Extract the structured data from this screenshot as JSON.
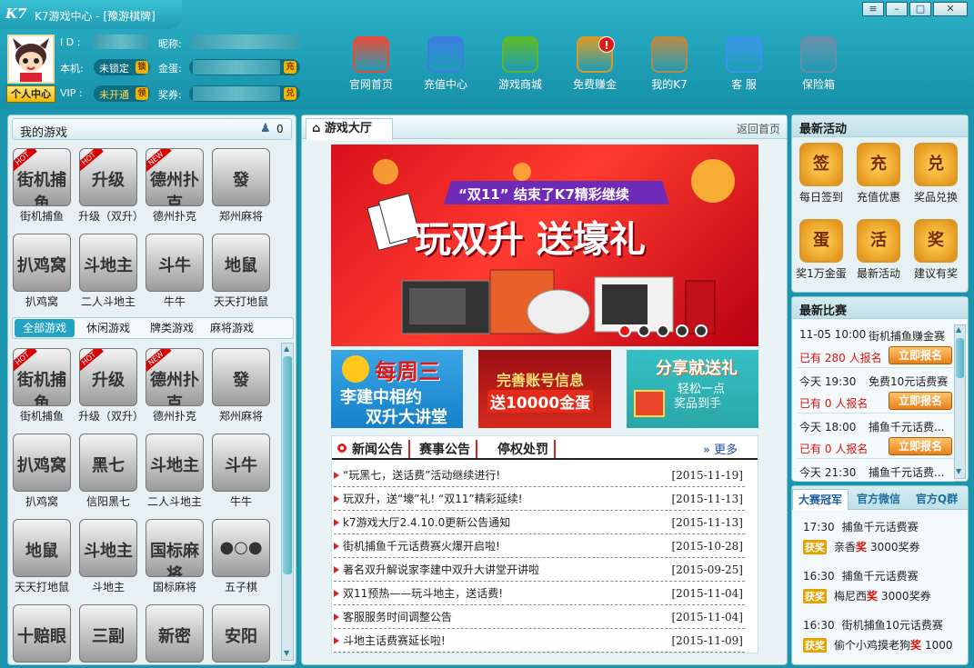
{
  "app": {
    "logo": "K7",
    "title": "K7游戏中心 - [豫游棋牌]"
  },
  "window_controls": {
    "menu": "≡",
    "minimize": "–",
    "maximize": "□",
    "close": "✕"
  },
  "user": {
    "id_label": "I D :",
    "nickname_label": "昵称:",
    "machine_label": "本机:",
    "machine_value": "未锁定",
    "eggs_label": "金蛋:",
    "vip_label": "VIP :",
    "vip_value": "未开通",
    "tickets_label": "奖券:",
    "personal_center": "个人中心",
    "coin_lock": "锁",
    "coin_vip": "领",
    "coin_egg": "充",
    "coin_ticket": "兑"
  },
  "nav": [
    {
      "label": "官网首页",
      "icon": "house-icon",
      "color": "#e84b3c"
    },
    {
      "label": "充值中心",
      "icon": "card-icon",
      "color": "#3b7de0"
    },
    {
      "label": "游戏商城",
      "icon": "basket-icon",
      "color": "#5cb82a"
    },
    {
      "label": "免费赚金",
      "icon": "money-bag-icon",
      "color": "#d89a28"
    },
    {
      "label": "我的K7",
      "icon": "user-icon",
      "color": "#b88946"
    },
    {
      "label": "客 服",
      "icon": "service-icon",
      "color": "#3a96e8"
    },
    {
      "label": "保险箱",
      "icon": "safe-icon",
      "color": "#6a8ea8"
    }
  ],
  "my_games": {
    "title": "我的游戏",
    "count": "0",
    "games": [
      {
        "name": "街机捕鱼",
        "glyph": "街机捕鱼",
        "tag": "HOT"
      },
      {
        "name": "升级（双升）",
        "glyph": "升级",
        "tag": "HOT"
      },
      {
        "name": "德州扑克",
        "glyph": "德州扑克",
        "tag": "NEW"
      },
      {
        "name": "郑州麻将",
        "glyph": "發",
        "tag": ""
      },
      {
        "name": "扒鸡窝",
        "glyph": "扒鸡窝",
        "tag": ""
      },
      {
        "name": "二人斗地主",
        "glyph": "斗地主",
        "tag": ""
      },
      {
        "name": "牛牛",
        "glyph": "斗牛",
        "tag": ""
      },
      {
        "name": "天天打地鼠",
        "glyph": "地鼠",
        "tag": ""
      }
    ]
  },
  "category_tabs": [
    "全部游戏",
    "休闲游戏",
    "牌类游戏",
    "麻将游戏"
  ],
  "all_games": [
    {
      "name": "街机捕鱼",
      "glyph": "街机捕鱼",
      "tag": "HOT"
    },
    {
      "name": "升级（双升）",
      "glyph": "升级",
      "tag": "HOT"
    },
    {
      "name": "德州扑克",
      "glyph": "德州扑克",
      "tag": "NEW"
    },
    {
      "name": "郑州麻将",
      "glyph": "發",
      "tag": ""
    },
    {
      "name": "扒鸡窝",
      "glyph": "扒鸡窝",
      "tag": ""
    },
    {
      "name": "信阳黑七",
      "glyph": "黑七",
      "tag": ""
    },
    {
      "name": "二人斗地主",
      "glyph": "斗地主",
      "tag": ""
    },
    {
      "name": "牛牛",
      "glyph": "斗牛",
      "tag": ""
    },
    {
      "name": "天天打地鼠",
      "glyph": "地鼠",
      "tag": ""
    },
    {
      "name": "斗地主",
      "glyph": "斗地主",
      "tag": ""
    },
    {
      "name": "国标麻将",
      "glyph": "国标麻将",
      "tag": ""
    },
    {
      "name": "五子棋",
      "glyph": "●○●",
      "tag": ""
    },
    {
      "name": "",
      "glyph": "十赔眼",
      "tag": ""
    },
    {
      "name": "",
      "glyph": "三副",
      "tag": ""
    },
    {
      "name": "",
      "glyph": "新密",
      "tag": ""
    },
    {
      "name": "",
      "glyph": "安阳",
      "tag": ""
    }
  ],
  "hall": {
    "tab": "游戏大厅",
    "back": "返回首页"
  },
  "banner": {
    "subtitle": "“双11” 结束了K7精彩继续",
    "title": "玩双升 送壕礼",
    "dots": 5
  },
  "promos": [
    {
      "line1": "每周三",
      "line2": "李建中相约",
      "line3": "双升大讲堂"
    },
    {
      "line1": "完善账号信息",
      "line2": "送10000金蛋"
    },
    {
      "line1": "分享就送礼",
      "line2": "轻松一点",
      "line3": "奖品到手"
    }
  ],
  "news": {
    "tabs": [
      "新闻公告",
      "赛事公告",
      "停权处罚"
    ],
    "more": "更多",
    "items": [
      {
        "title": "“玩黑七，送话费”活动继续进行!",
        "date": "[2015-11-19]"
      },
      {
        "title": "玩双升，送“壕”礼! “双11”精彩延续!",
        "date": "[2015-11-13]"
      },
      {
        "title": "k7游戏大厅2.4.10.0更新公告通知",
        "date": "[2015-11-13]"
      },
      {
        "title": "街机捕鱼千元话费赛火爆开启啦!",
        "date": "[2015-10-28]"
      },
      {
        "title": "著名双升解说家李建中双升大讲堂开讲啦",
        "date": "[2015-09-25]"
      },
      {
        "title": "双11预热——玩斗地主，送话费!",
        "date": "[2015-11-04]"
      },
      {
        "title": "客服服务时间调整公告",
        "date": "[2015-11-04]"
      },
      {
        "title": "斗地主话费赛延长啦!",
        "date": "[2015-11-09]"
      }
    ]
  },
  "activities": {
    "title": "最新活动",
    "items": [
      {
        "label": "每日签到",
        "glyph": "签"
      },
      {
        "label": "充值优惠",
        "glyph": "充"
      },
      {
        "label": "奖品兑换",
        "glyph": "兑"
      },
      {
        "label": "奖1万金蛋",
        "glyph": "蛋"
      },
      {
        "label": "最新活动",
        "glyph": "活"
      },
      {
        "label": "建议有奖",
        "glyph": "奖"
      }
    ]
  },
  "matches": {
    "title": "最新比赛",
    "signup": "立即报名",
    "items": [
      {
        "time": "11-05 10:00",
        "name": "街机捕鱼赚金赛",
        "pre": "已有",
        "count": "280",
        "post": "人报名"
      },
      {
        "time": "今天 19:30",
        "name": "免费10元话费赛",
        "pre": "已有",
        "count": "0",
        "post": "人报名"
      },
      {
        "time": "今天 18:00",
        "name": "捕鱼千元话费...",
        "pre": "已有",
        "count": "0",
        "post": "人报名"
      },
      {
        "time": "今天 21:30",
        "name": "捕鱼千元话费...",
        "pre": "",
        "count": "",
        "post": ""
      }
    ]
  },
  "champions": {
    "tabs": [
      "大赛冠军",
      "官方微信",
      "官方Q群"
    ],
    "award_label": "获奖",
    "prize_word": "奖",
    "items": [
      {
        "time": "17:30",
        "match": "捕鱼千元话费赛",
        "user": "亲香",
        "prize": "3000奖券"
      },
      {
        "time": "16:30",
        "match": "捕鱼千元话费赛",
        "user": "梅尼西",
        "prize": "3000奖券"
      },
      {
        "time": "16:30",
        "match": "街机捕鱼10元话费赛",
        "user": "偷个小鸡摸老狗",
        "prize": "1000"
      }
    ]
  }
}
